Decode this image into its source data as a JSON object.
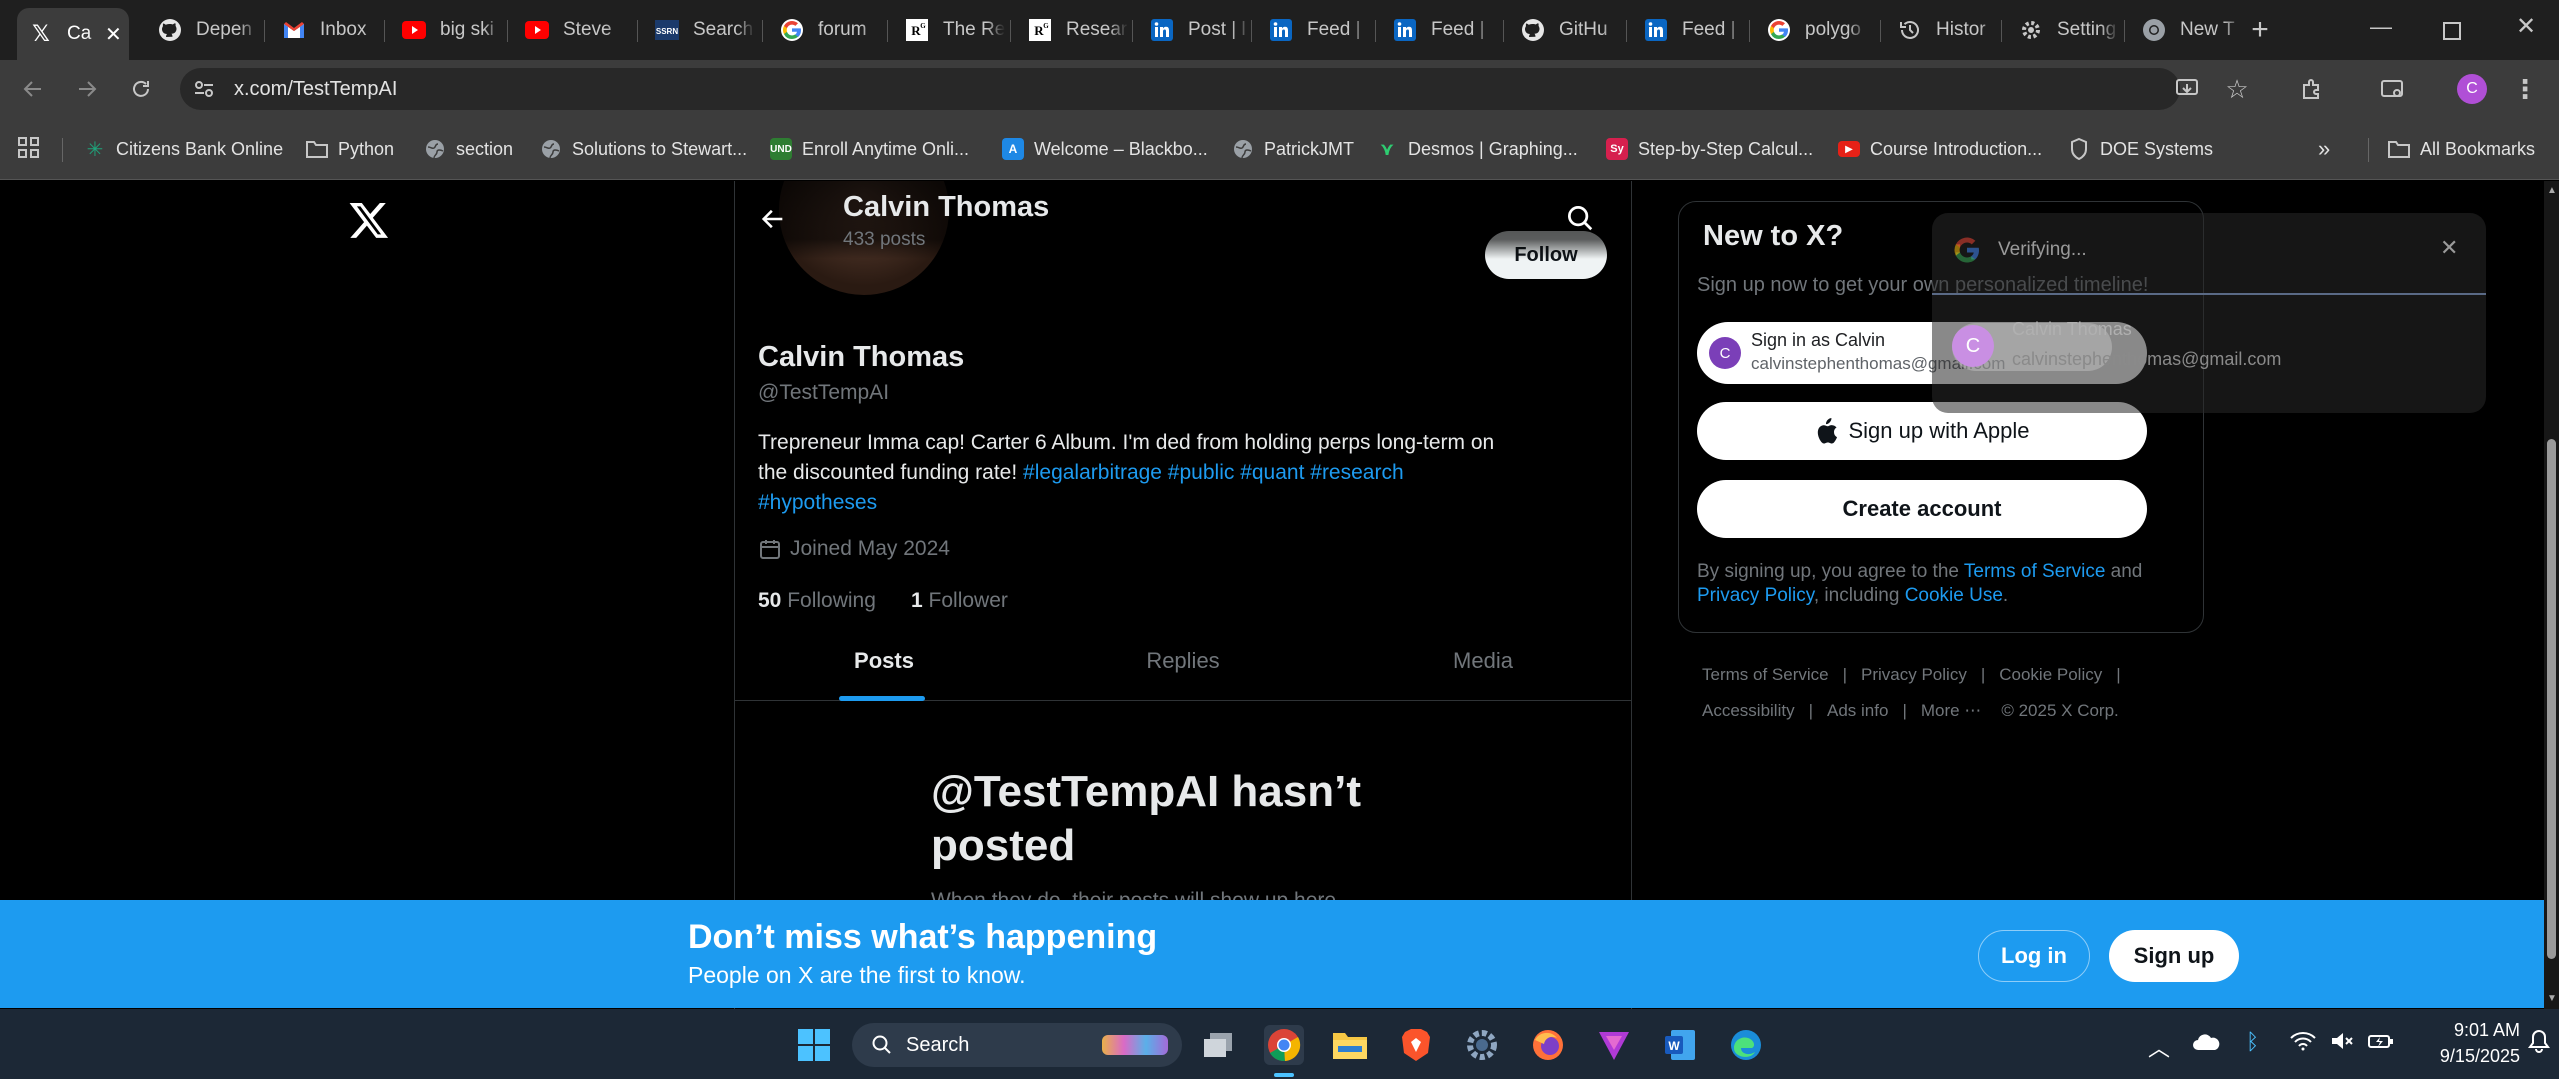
{
  "tabs": [
    {
      "label": "Ca",
      "icon": "x-logo-icon",
      "active": true
    },
    {
      "label": "Depen",
      "icon": "github-icon"
    },
    {
      "label": "Inbox",
      "icon": "gmail-icon"
    },
    {
      "label": "big ski",
      "icon": "youtube-icon"
    },
    {
      "label": "Steve",
      "icon": "youtube-icon"
    },
    {
      "label": "Search",
      "icon": "ssrn-icon"
    },
    {
      "label": "forum",
      "icon": "google-icon"
    },
    {
      "label": "The Re",
      "icon": "researchgate-icon"
    },
    {
      "label": "Resear",
      "icon": "researchgate-icon"
    },
    {
      "label": "Post | l",
      "icon": "linkedin-icon"
    },
    {
      "label": "Feed |",
      "icon": "linkedin-icon"
    },
    {
      "label": "Feed |",
      "icon": "linkedin-icon"
    },
    {
      "label": "GitHu",
      "icon": "github-icon"
    },
    {
      "label": "Feed |",
      "icon": "linkedin-icon"
    },
    {
      "label": "polygo",
      "icon": "google-icon"
    },
    {
      "label": "Histor",
      "icon": "history-icon"
    },
    {
      "label": "Setting",
      "icon": "gear-icon"
    },
    {
      "label": "New T",
      "icon": "chrome-icon"
    }
  ],
  "address": {
    "url": "x.com/TestTempAI"
  },
  "profile_initial": "C",
  "bookmarks": [
    {
      "label": "Citizens Bank Online"
    },
    {
      "label": "Python"
    },
    {
      "label": "section"
    },
    {
      "label": "Solutions to Stewart..."
    },
    {
      "label": "Enroll Anytime Onli..."
    },
    {
      "label": "Welcome – Blackbo..."
    },
    {
      "label": "PatrickJMT"
    },
    {
      "label": "Desmos | Graphing..."
    },
    {
      "label": "Step-by-Step Calcul..."
    },
    {
      "label": "Course Introduction..."
    },
    {
      "label": "DOE Systems"
    }
  ],
  "bookmarks_all": "All Bookmarks",
  "header": {
    "name": "Calvin Thomas",
    "posts": "433 posts",
    "follow_label": "Follow"
  },
  "profile": {
    "name": "Calvin Thomas",
    "handle": "@TestTempAI",
    "bio_line1": "Trepreneur Imma cap! Carter 6 Album. I'm ded from holding perps long-term on",
    "bio_line2_text": "the discounted funding rate!",
    "hashtags_line2": "#legalarbitrage #public #quant #research",
    "hashtags_line3": "#hypotheses",
    "joined": "Joined May 2024",
    "following_count": "50",
    "following_label": "Following",
    "followers_count": "1",
    "followers_label": "Follower"
  },
  "profile_tabs": [
    "Posts",
    "Replies",
    "Media"
  ],
  "empty": {
    "title_line1": "@TestTempAI hasn’t",
    "title_line2": "posted",
    "subtitle": "When they do, their posts will show up here."
  },
  "signup": {
    "title": "New to X?",
    "subtitle": "Sign up now to get your own personalized timeline!",
    "google_name": "Sign in as Calvin",
    "google_email": "calvinstephenthomas@gmail.com",
    "apple_label": "Sign up with Apple",
    "create_label": "Create account",
    "terms_pre": "By signing up, you agree to the",
    "terms_link": "Terms of Service",
    "and": "and",
    "privacy_link": "Privacy Policy",
    "including": ", including",
    "cookie_link": "Cookie Use",
    "period": "."
  },
  "footer": {
    "links_row1": [
      "Terms of Service",
      "Privacy Policy",
      "Cookie Policy"
    ],
    "links_row2": [
      "Accessibility",
      "Ads info",
      "More ⋯",
      "© 2025 X Corp."
    ]
  },
  "google_popup": {
    "status": "Verifying...",
    "name": "Calvin Thomas",
    "email": "calvinstephenthomas@gmail.com",
    "initial": "C"
  },
  "banner": {
    "title": "Don’t miss what’s happening",
    "subtitle": "People on X are the first to know.",
    "login": "Log in",
    "signup": "Sign up"
  },
  "taskbar": {
    "search": "Search",
    "time": "9:01 AM",
    "date": "9/15/2025"
  },
  "colors": {
    "accent": "#1d9bf0",
    "background": "#000000",
    "taskbar": "#1c2836"
  }
}
